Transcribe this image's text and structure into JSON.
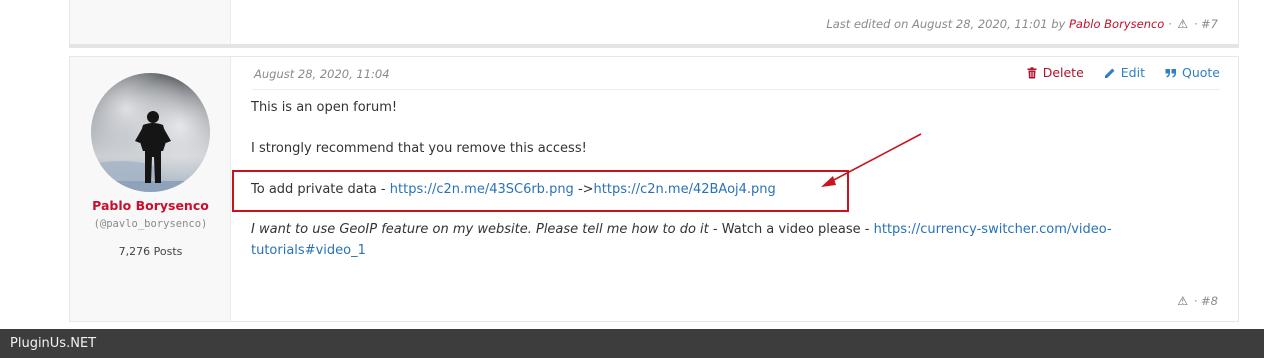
{
  "prev_post": {
    "edited_prefix": "Last edited on August 28, 2020, 11:01 by",
    "editor": "Pablo Borysenco",
    "dot1": "·",
    "dot2": "·",
    "number": "#7",
    "report_icon": "warning-icon"
  },
  "post": {
    "author": {
      "name": "Pablo Borysenco",
      "handle": "(@pavlo_borysenco)",
      "posts": "7,276 Posts",
      "avatar": "avatar-photo"
    },
    "date": "August 28, 2020, 11:04",
    "actions": {
      "delete": "Delete",
      "edit": "Edit",
      "quote": "Quote",
      "delete_icon": "trash-icon",
      "edit_icon": "pencil-icon",
      "quote_icon": "quote-icon"
    },
    "body": {
      "line1": "This is an open forum!",
      "line2": "I strongly recommend that you remove this access!",
      "line3_text": "To add  private  data - ",
      "line3_link1": "https://c2n.me/43SC6rb.png",
      "line3_mid": " ->",
      "line3_link2": "https://c2n.me/42BAoj4.png",
      "line4_italic": "I want to use GeoIP feature on my website. Please tell me how to do it",
      "line4_text": " - Watch a  video please - ",
      "line4_link": "https://currency-switcher.com/video-tutorials#video_1"
    },
    "footer": {
      "dot": "·",
      "number": "#8",
      "report_icon": "warning-icon"
    },
    "annotation": {
      "box_color": "#c8141e",
      "arrow_color": "#c8141e"
    }
  },
  "site_bar": {
    "label": "PluginUs.NET"
  },
  "colors": {
    "author_name": "#c8102e",
    "link": "#2a72b8",
    "delete": "#b0102a",
    "footer_bar": "#3d3d3d"
  }
}
